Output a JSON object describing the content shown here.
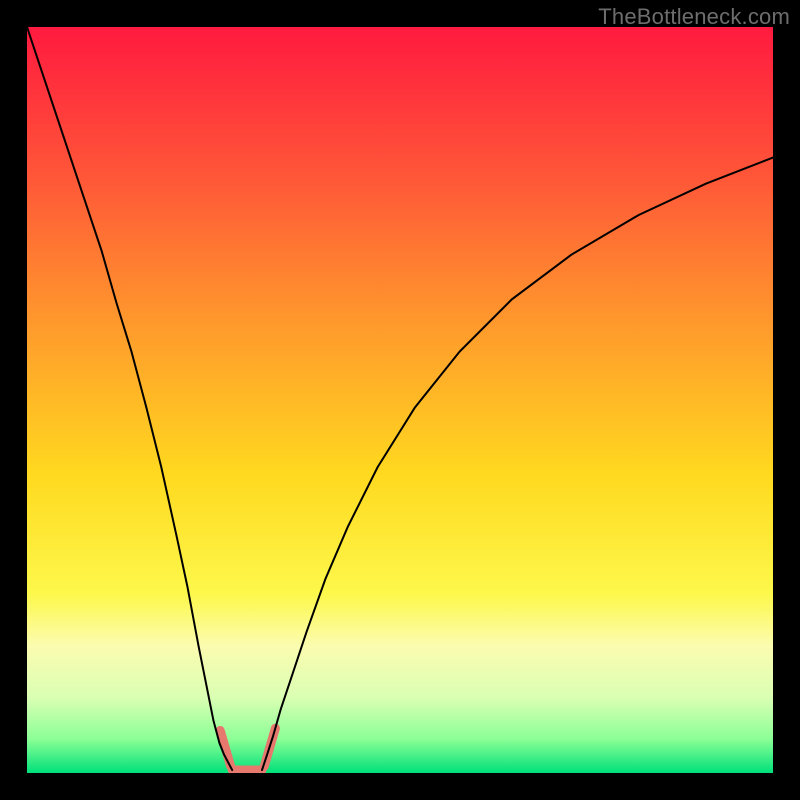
{
  "watermark": "TheBottleneck.com",
  "chart_data": {
    "type": "line",
    "title": "",
    "xlabel": "",
    "ylabel": "",
    "xlim": [
      0,
      100
    ],
    "ylim": [
      0,
      100
    ],
    "legend": false,
    "grid": false,
    "background_gradient": {
      "stops": [
        {
          "offset": 0.0,
          "color": "#ff1a3f"
        },
        {
          "offset": 0.2,
          "color": "#ff5638"
        },
        {
          "offset": 0.4,
          "color": "#ff9a2c"
        },
        {
          "offset": 0.6,
          "color": "#ffd91f"
        },
        {
          "offset": 0.76,
          "color": "#fdf84b"
        },
        {
          "offset": 0.83,
          "color": "#fbfcb0"
        },
        {
          "offset": 0.9,
          "color": "#d9ffb3"
        },
        {
          "offset": 0.955,
          "color": "#8aff96"
        },
        {
          "offset": 1.0,
          "color": "#00e07a"
        }
      ]
    },
    "series": [
      {
        "name": "left-branch",
        "stroke": "#000000",
        "stroke_width": 2,
        "x": [
          0,
          2,
          4,
          6,
          8,
          10,
          12,
          14,
          16,
          18,
          20,
          21.5,
          23,
          24,
          25,
          25.8,
          26.4,
          27.5
        ],
        "y": [
          100,
          94,
          88,
          82,
          76,
          70,
          63,
          56.5,
          49,
          41,
          32,
          25,
          17,
          12,
          7,
          4,
          2.5,
          0.4
        ]
      },
      {
        "name": "right-branch",
        "stroke": "#000000",
        "stroke_width": 2,
        "x": [
          31.5,
          32.2,
          33,
          34,
          35.5,
          37.5,
          40,
          43,
          47,
          52,
          58,
          65,
          73,
          82,
          91,
          100
        ],
        "y": [
          0.4,
          2.5,
          5,
          8.5,
          13,
          19,
          26,
          33,
          41,
          49,
          56.5,
          63.5,
          69.5,
          74.8,
          79,
          82.5
        ]
      },
      {
        "name": "valley-floor",
        "stroke": "#e6786e",
        "stroke_width": 9,
        "linecap": "round",
        "x": [
          27.5,
          31.5
        ],
        "y": [
          0.4,
          0.4
        ]
      }
    ],
    "markers": [
      {
        "name": "left-wall-marker",
        "stroke": "#e6786e",
        "stroke_width": 9,
        "linecap": "round",
        "x1": 25.9,
        "y1": 5.7,
        "x2": 27.3,
        "y2": 0.9
      },
      {
        "name": "right-wall-marker",
        "stroke": "#e6786e",
        "stroke_width": 9,
        "linecap": "round",
        "x1": 31.8,
        "y1": 0.9,
        "x2": 33.3,
        "y2": 6.0
      }
    ]
  }
}
